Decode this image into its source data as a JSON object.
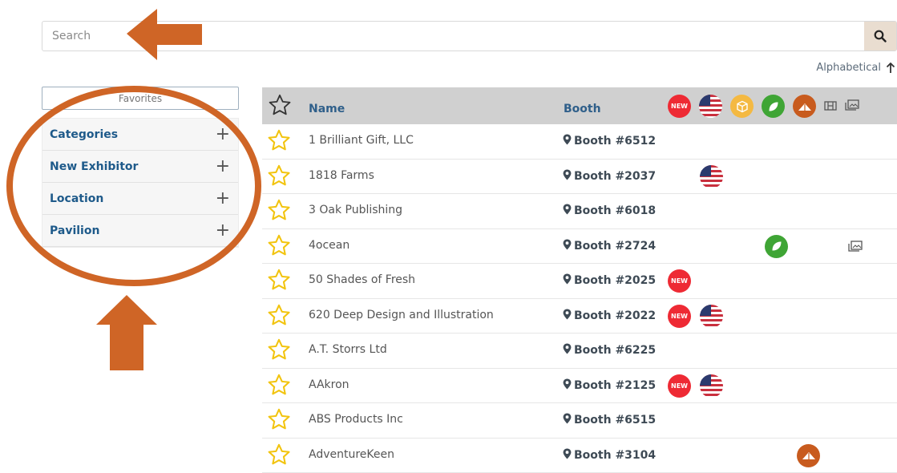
{
  "search": {
    "placeholder": "Search"
  },
  "sort": {
    "label": "Alphabetical"
  },
  "sidebar": {
    "favorites_label": "Favorites",
    "filters": [
      {
        "label": "Categories"
      },
      {
        "label": "New Exhibitor"
      },
      {
        "label": "Location"
      },
      {
        "label": "Pavilion"
      }
    ]
  },
  "table": {
    "headers": {
      "name": "Name",
      "booth": "Booth"
    },
    "header_icons": [
      "new-badge-icon",
      "usa-flag-icon",
      "box-icon",
      "leaf-icon",
      "tent-icon",
      "film-icon",
      "photos-icon"
    ],
    "new_badge_text": "NEW",
    "rows": [
      {
        "name": "1 Brilliant Gift, LLC",
        "booth": "Booth #6512",
        "badges": []
      },
      {
        "name": "1818 Farms",
        "booth": "Booth #2037",
        "badges": [
          "usa"
        ]
      },
      {
        "name": "3 Oak Publishing",
        "booth": "Booth #6018",
        "badges": []
      },
      {
        "name": "4ocean",
        "booth": "Booth #2724",
        "badges": [
          "leaf",
          "photos"
        ]
      },
      {
        "name": "50 Shades of Fresh",
        "booth": "Booth #2025",
        "badges": [
          "new"
        ]
      },
      {
        "name": "620 Deep Design and Illustration",
        "booth": "Booth #2022",
        "badges": [
          "new",
          "usa"
        ]
      },
      {
        "name": "A.T. Storrs Ltd",
        "booth": "Booth #6225",
        "badges": []
      },
      {
        "name": "AAkron",
        "booth": "Booth #2125",
        "badges": [
          "new",
          "usa"
        ]
      },
      {
        "name": "ABS Products Inc",
        "booth": "Booth #6515",
        "badges": []
      },
      {
        "name": "AdventureKeen",
        "booth": "Booth #3104",
        "badges": [
          "tent"
        ]
      }
    ]
  },
  "colors": {
    "annotation": "#cf6526",
    "link_blue": "#1e5a8a",
    "new_red": "#ee2a34",
    "star_yellow": "#f2c40f"
  }
}
